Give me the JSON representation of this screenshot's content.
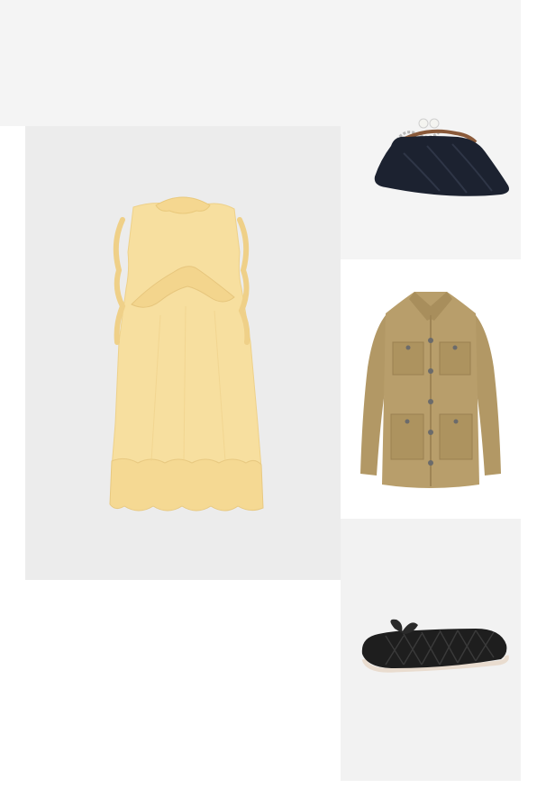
{
  "outfit": {
    "products": [
      {
        "name": "Yellow ruffle sleeveless dress",
        "icon": "dress-icon",
        "color": "#f5dc97"
      },
      {
        "name": "Black pleated clutch bag",
        "icon": "clutch-bag-icon",
        "color": "#1c2230"
      },
      {
        "name": "Khaki field jacket",
        "icon": "jacket-icon",
        "color": "#b49a66"
      },
      {
        "name": "Black woven ballet flat",
        "icon": "ballet-flat-icon",
        "color": "#1e1e1e"
      }
    ]
  }
}
